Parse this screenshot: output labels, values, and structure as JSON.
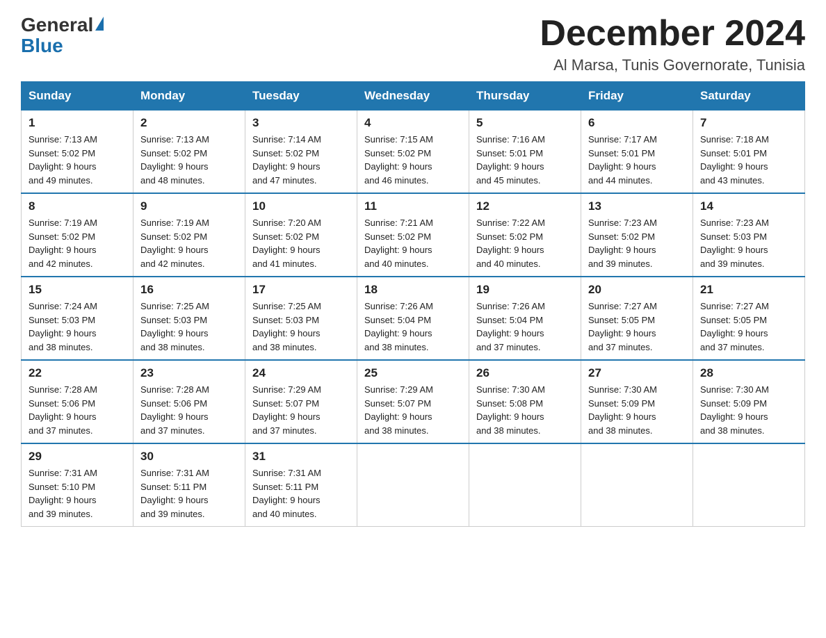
{
  "logo": {
    "general": "General",
    "blue": "Blue"
  },
  "header": {
    "month": "December 2024",
    "location": "Al Marsa, Tunis Governorate, Tunisia"
  },
  "days_of_week": [
    "Sunday",
    "Monday",
    "Tuesday",
    "Wednesday",
    "Thursday",
    "Friday",
    "Saturday"
  ],
  "weeks": [
    [
      {
        "day": "1",
        "sunrise": "7:13 AM",
        "sunset": "5:02 PM",
        "daylight": "9 hours and 49 minutes."
      },
      {
        "day": "2",
        "sunrise": "7:13 AM",
        "sunset": "5:02 PM",
        "daylight": "9 hours and 48 minutes."
      },
      {
        "day": "3",
        "sunrise": "7:14 AM",
        "sunset": "5:02 PM",
        "daylight": "9 hours and 47 minutes."
      },
      {
        "day": "4",
        "sunrise": "7:15 AM",
        "sunset": "5:02 PM",
        "daylight": "9 hours and 46 minutes."
      },
      {
        "day": "5",
        "sunrise": "7:16 AM",
        "sunset": "5:01 PM",
        "daylight": "9 hours and 45 minutes."
      },
      {
        "day": "6",
        "sunrise": "7:17 AM",
        "sunset": "5:01 PM",
        "daylight": "9 hours and 44 minutes."
      },
      {
        "day": "7",
        "sunrise": "7:18 AM",
        "sunset": "5:01 PM",
        "daylight": "9 hours and 43 minutes."
      }
    ],
    [
      {
        "day": "8",
        "sunrise": "7:19 AM",
        "sunset": "5:02 PM",
        "daylight": "9 hours and 42 minutes."
      },
      {
        "day": "9",
        "sunrise": "7:19 AM",
        "sunset": "5:02 PM",
        "daylight": "9 hours and 42 minutes."
      },
      {
        "day": "10",
        "sunrise": "7:20 AM",
        "sunset": "5:02 PM",
        "daylight": "9 hours and 41 minutes."
      },
      {
        "day": "11",
        "sunrise": "7:21 AM",
        "sunset": "5:02 PM",
        "daylight": "9 hours and 40 minutes."
      },
      {
        "day": "12",
        "sunrise": "7:22 AM",
        "sunset": "5:02 PM",
        "daylight": "9 hours and 40 minutes."
      },
      {
        "day": "13",
        "sunrise": "7:23 AM",
        "sunset": "5:02 PM",
        "daylight": "9 hours and 39 minutes."
      },
      {
        "day": "14",
        "sunrise": "7:23 AM",
        "sunset": "5:03 PM",
        "daylight": "9 hours and 39 minutes."
      }
    ],
    [
      {
        "day": "15",
        "sunrise": "7:24 AM",
        "sunset": "5:03 PM",
        "daylight": "9 hours and 38 minutes."
      },
      {
        "day": "16",
        "sunrise": "7:25 AM",
        "sunset": "5:03 PM",
        "daylight": "9 hours and 38 minutes."
      },
      {
        "day": "17",
        "sunrise": "7:25 AM",
        "sunset": "5:03 PM",
        "daylight": "9 hours and 38 minutes."
      },
      {
        "day": "18",
        "sunrise": "7:26 AM",
        "sunset": "5:04 PM",
        "daylight": "9 hours and 38 minutes."
      },
      {
        "day": "19",
        "sunrise": "7:26 AM",
        "sunset": "5:04 PM",
        "daylight": "9 hours and 37 minutes."
      },
      {
        "day": "20",
        "sunrise": "7:27 AM",
        "sunset": "5:05 PM",
        "daylight": "9 hours and 37 minutes."
      },
      {
        "day": "21",
        "sunrise": "7:27 AM",
        "sunset": "5:05 PM",
        "daylight": "9 hours and 37 minutes."
      }
    ],
    [
      {
        "day": "22",
        "sunrise": "7:28 AM",
        "sunset": "5:06 PM",
        "daylight": "9 hours and 37 minutes."
      },
      {
        "day": "23",
        "sunrise": "7:28 AM",
        "sunset": "5:06 PM",
        "daylight": "9 hours and 37 minutes."
      },
      {
        "day": "24",
        "sunrise": "7:29 AM",
        "sunset": "5:07 PM",
        "daylight": "9 hours and 37 minutes."
      },
      {
        "day": "25",
        "sunrise": "7:29 AM",
        "sunset": "5:07 PM",
        "daylight": "9 hours and 38 minutes."
      },
      {
        "day": "26",
        "sunrise": "7:30 AM",
        "sunset": "5:08 PM",
        "daylight": "9 hours and 38 minutes."
      },
      {
        "day": "27",
        "sunrise": "7:30 AM",
        "sunset": "5:09 PM",
        "daylight": "9 hours and 38 minutes."
      },
      {
        "day": "28",
        "sunrise": "7:30 AM",
        "sunset": "5:09 PM",
        "daylight": "9 hours and 38 minutes."
      }
    ],
    [
      {
        "day": "29",
        "sunrise": "7:31 AM",
        "sunset": "5:10 PM",
        "daylight": "9 hours and 39 minutes."
      },
      {
        "day": "30",
        "sunrise": "7:31 AM",
        "sunset": "5:11 PM",
        "daylight": "9 hours and 39 minutes."
      },
      {
        "day": "31",
        "sunrise": "7:31 AM",
        "sunset": "5:11 PM",
        "daylight": "9 hours and 40 minutes."
      },
      null,
      null,
      null,
      null
    ]
  ],
  "labels": {
    "sunrise": "Sunrise:",
    "sunset": "Sunset:",
    "daylight": "Daylight:"
  }
}
